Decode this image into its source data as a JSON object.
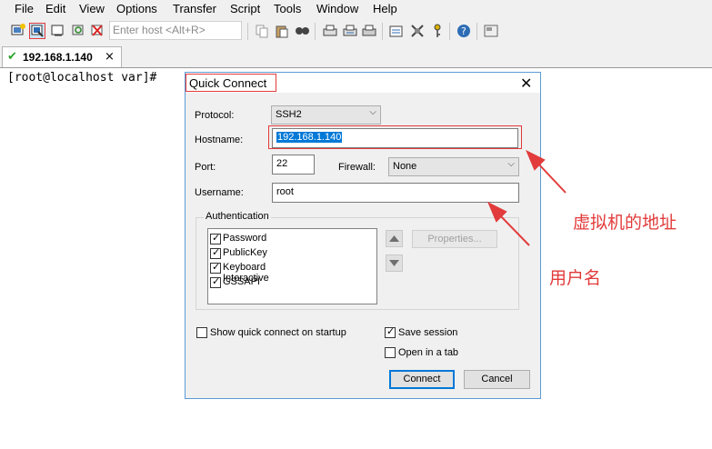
{
  "menu": [
    "File",
    "Edit",
    "View",
    "Options",
    "Transfer",
    "Script",
    "Tools",
    "Window",
    "Help"
  ],
  "toolbar": {
    "host_placeholder": "Enter host <Alt+R>"
  },
  "tab": {
    "label": "192.168.1.140",
    "close": "×"
  },
  "terminal": {
    "prompt": "[root@localhost var]#"
  },
  "dialog": {
    "title": "Quick Connect",
    "close": "✕",
    "protocol_label": "Protocol:",
    "protocol_value": "SSH2",
    "hostname_label": "Hostname:",
    "hostname_value": "192.168.1.140",
    "port_label": "Port:",
    "port_value": "22",
    "firewall_label": "Firewall:",
    "firewall_value": "None",
    "username_label": "Username:",
    "username_value": "root",
    "auth_title": "Authentication",
    "auth_methods": [
      {
        "label": "Password",
        "checked": true
      },
      {
        "label": "PublicKey",
        "checked": true
      },
      {
        "label": "Keyboard Interactive",
        "checked": true
      },
      {
        "label": "GSSAPI",
        "checked": true
      }
    ],
    "properties_button": "Properties...",
    "show_on_startup": {
      "label": "Show quick connect on startup",
      "checked": false
    },
    "save_session": {
      "label": "Save session",
      "checked": true
    },
    "open_in_tab": {
      "label": "Open in a tab",
      "checked": false
    },
    "connect_button": "Connect",
    "cancel_button": "Cancel"
  },
  "annotations": {
    "vm_address": "虚拟机的地址",
    "username": "用户名"
  },
  "colors": {
    "annotation_red": "#e23b3b",
    "selection_blue": "#0078d7",
    "check_green": "#2aa52a"
  }
}
